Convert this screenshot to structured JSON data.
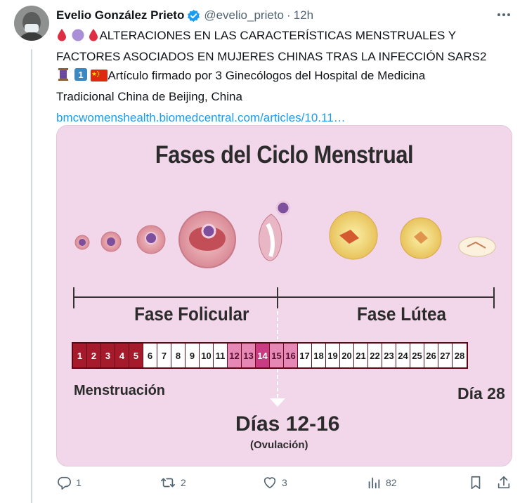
{
  "author": {
    "name": "Evelio González Prieto",
    "handle": "@evelio_prieto",
    "separator": "·",
    "time": "12h"
  },
  "tweet": {
    "line1": "ALTERACIONES EN LAS CARACTERÍSTICAS MENSTRUALES Y",
    "line2": "FACTORES ASOCIADOS EN MUJERES CHINAS TRAS LA INFECCIÓN SARS2",
    "line3": "Artículo firmado por 3 Ginecólogos del Hospital de Medicina",
    "line4": "Tradicional China de Beijing, China",
    "link": "bmcwomenshealth.biomedcentral.com/articles/10.11…",
    "keycap_digit": "1",
    "emoji_line1": [
      "blood-drop",
      "purple-circle",
      "blood-drop"
    ],
    "emoji_line3": [
      "thread-spool",
      "keycap-1",
      "china-flag"
    ]
  },
  "infographic": {
    "title": "Fases del Ciclo Menstrual",
    "phase_follicular": "Fase Folicular",
    "phase_luteal": "Fase Lútea",
    "days": [
      "1",
      "2",
      "3",
      "4",
      "5",
      "6",
      "7",
      "8",
      "9",
      "10",
      "11",
      "12",
      "13",
      "14",
      "15",
      "16",
      "17",
      "18",
      "19",
      "20",
      "21",
      "22",
      "23",
      "24",
      "25",
      "26",
      "27",
      "28"
    ],
    "day_kinds": [
      "m",
      "m",
      "m",
      "m",
      "m",
      "n",
      "n",
      "n",
      "n",
      "n",
      "n",
      "o",
      "o",
      "p",
      "o",
      "o",
      "n",
      "n",
      "n",
      "n",
      "n",
      "n",
      "n",
      "n",
      "n",
      "n",
      "n",
      "n"
    ],
    "menstruation_label": "Menstruación",
    "day28_label": "Día 28",
    "ovulation_days": "Días 12-16",
    "ovulation_label": "(Ovulación)",
    "colors": {
      "menstruation": "#a51b2b",
      "ovulation_light": "#e588b6",
      "ovulation_peak": "#c93c82",
      "normal": "#ffffff"
    }
  },
  "actions": {
    "replies": "1",
    "retweets": "2",
    "likes": "3",
    "views": "82"
  },
  "colors": {
    "accent": "#1d9bf0",
    "muted": "#536471",
    "card_bg": "#f2d7ea"
  }
}
